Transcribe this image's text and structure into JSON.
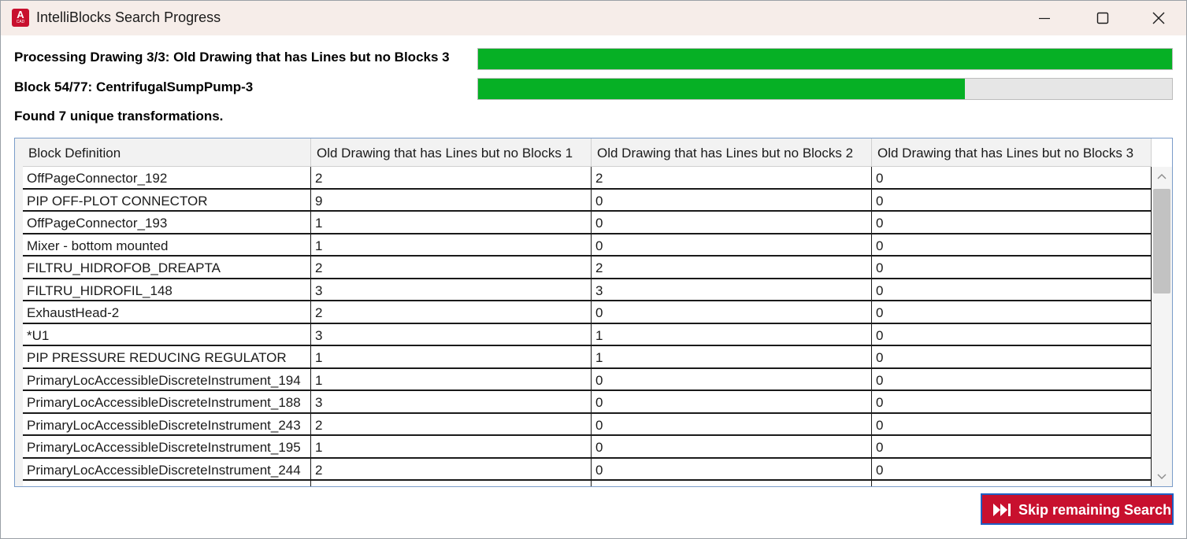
{
  "window": {
    "title": "IntelliBlocks Search Progress",
    "app_icon": {
      "letter": "A",
      "caption": "CAD",
      "color": "#c8102e"
    },
    "controls": [
      "minimize-icon",
      "maximize-icon",
      "close-icon"
    ]
  },
  "progress": {
    "drawing_label": "Processing Drawing 3/3: Old Drawing that has Lines but no Blocks 3",
    "drawing_progress": 1.0,
    "block_label": "Block 54/77: CentrifugalSumpPump-3",
    "block_progress": 0.7013,
    "bar_color": "#06b025"
  },
  "summary": "Found 7 unique transformations.",
  "table": {
    "columns": [
      "Block Definition",
      "Old Drawing that has Lines but no Blocks 1",
      "Old Drawing that has Lines but no Blocks 2",
      "Old Drawing that has Lines but no Blocks 3"
    ],
    "rows": [
      [
        "OffPageConnector_192",
        "2",
        "2",
        "0"
      ],
      [
        "PIP OFF-PLOT CONNECTOR",
        "9",
        "0",
        "0"
      ],
      [
        "OffPageConnector_193",
        "1",
        "0",
        "0"
      ],
      [
        "Mixer - bottom mounted",
        "1",
        "0",
        "0"
      ],
      [
        "FILTRU_HIDROFOB_DREAPTA",
        "2",
        "2",
        "0"
      ],
      [
        "FILTRU_HIDROFIL_148",
        "3",
        "3",
        "0"
      ],
      [
        "ExhaustHead-2",
        "2",
        "0",
        "0"
      ],
      [
        "*U1",
        "3",
        "1",
        "0"
      ],
      [
        "PIP PRESSURE REDUCING REGULATOR",
        "1",
        "1",
        "0"
      ],
      [
        "PrimaryLocAccessibleDiscreteInstrument_194",
        "1",
        "0",
        "0"
      ],
      [
        "PrimaryLocAccessibleDiscreteInstrument_188",
        "3",
        "0",
        "0"
      ],
      [
        "PrimaryLocAccessibleDiscreteInstrument_243",
        "2",
        "0",
        "0"
      ],
      [
        "PrimaryLocAccessibleDiscreteInstrument_195",
        "1",
        "0",
        "0"
      ],
      [
        "PrimaryLocAccessibleDiscreteInstrument_244",
        "2",
        "0",
        "0"
      ]
    ]
  },
  "skip_button": {
    "label": "Skip remaining Search",
    "icon": "skip-forward-icon",
    "color": "#c8102e"
  }
}
